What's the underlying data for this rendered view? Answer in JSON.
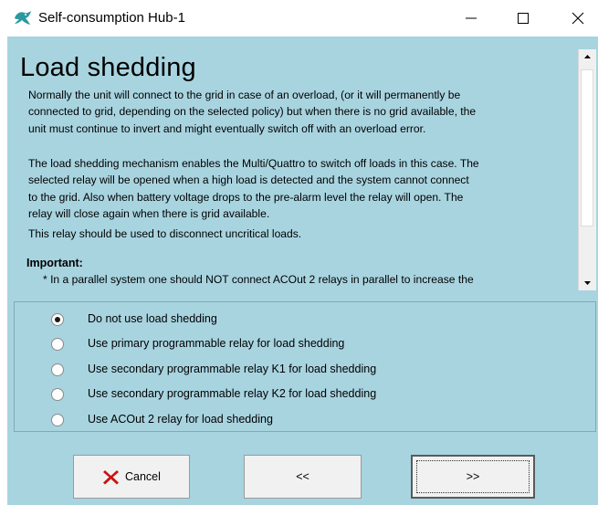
{
  "window": {
    "title": "Self-consumption Hub-1",
    "icon": "victron-logo-icon",
    "controls": [
      "minimize-icon",
      "maximize-icon",
      "close-icon"
    ]
  },
  "info": {
    "title": "Load shedding",
    "paragraph1": [
      "Normally the unit will connect to the grid in case of an overload, (or it will permanently be",
      "connected to grid, depending on the selected policy) but when there is no grid available, the",
      "unit must continue to invert and might eventually switch off with an overload error."
    ],
    "paragraph2": [
      "The load shedding mechanism enables the Multi/Quattro to switch off loads in this case. The",
      "selected relay will be opened when a high load is detected and the system cannot connect",
      "to the grid. Also when battery voltage drops to the pre-alarm level the relay will open. The",
      "relay will close again when there is grid available."
    ],
    "paragraph3": "This relay should be used to disconnect uncritical loads.",
    "important_label": "Important:",
    "important_bullet": "*  In a parallel system one should NOT connect ACOut 2 relays in parallel to increase the"
  },
  "options": {
    "selected_index": 0,
    "items": [
      "Do not use load shedding",
      "Use primary programmable relay for load shedding",
      "Use secondary programmable relay K1 for load shedding",
      "Use secondary programmable relay K2 for load shedding",
      "Use ACOut 2 relay for load shedding"
    ]
  },
  "buttons": {
    "cancel": "Cancel",
    "back": "<<",
    "next": ">>"
  },
  "colors": {
    "background": "#a8d4e0",
    "cancel_icon": "#cc1111",
    "logo": "#2a9aa0"
  }
}
